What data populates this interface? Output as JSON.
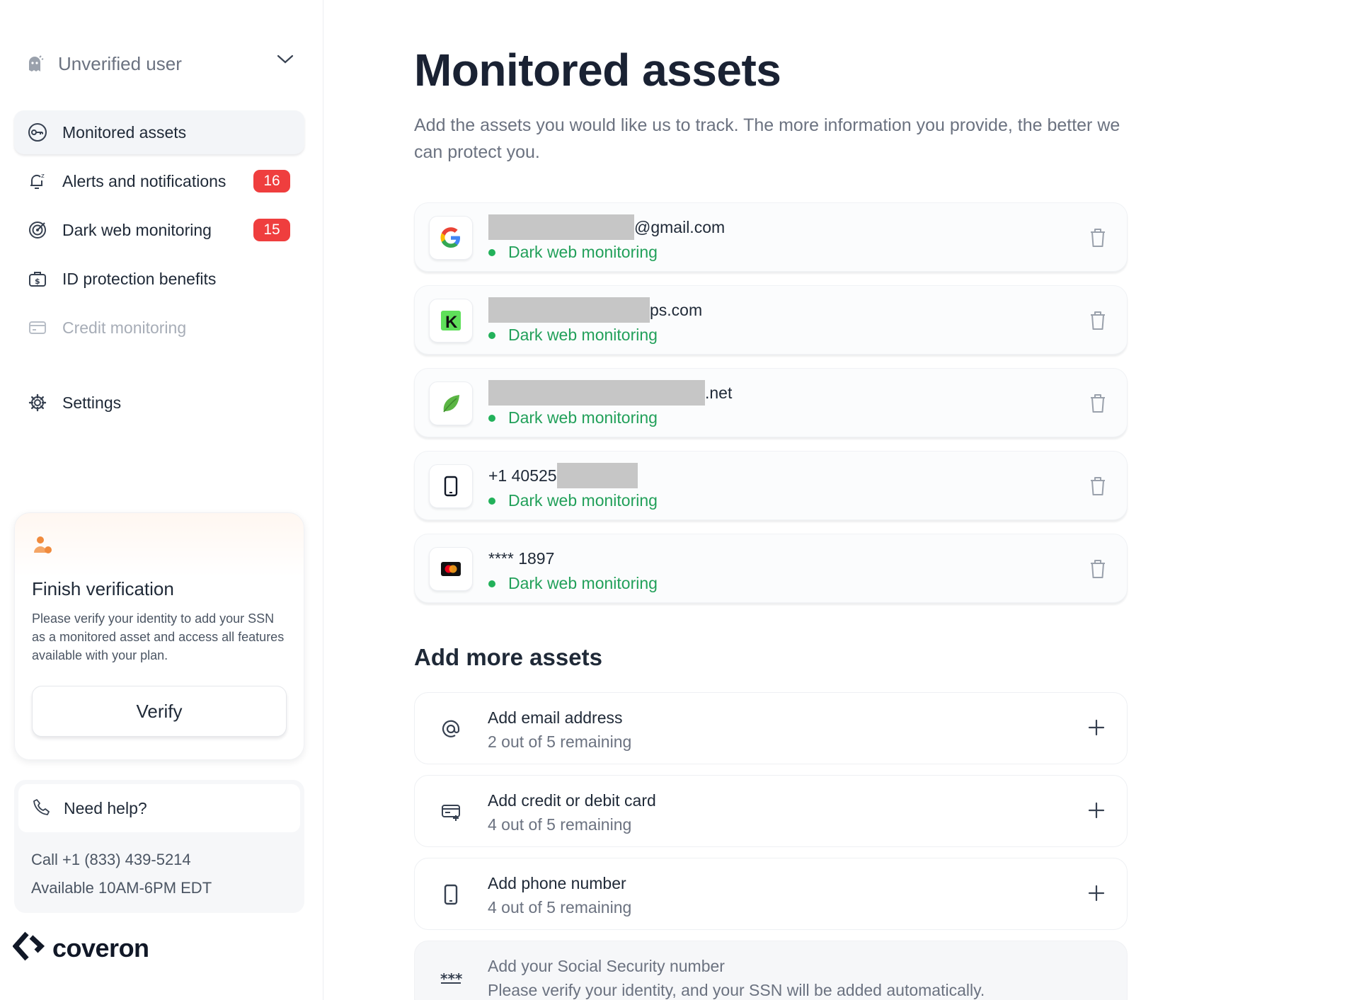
{
  "user": {
    "name": "Unverified user"
  },
  "nav": {
    "items": [
      {
        "label": "Monitored assets"
      },
      {
        "label": "Alerts and notifications",
        "badge": "16"
      },
      {
        "label": "Dark web monitoring",
        "badge": "15"
      },
      {
        "label": "ID protection benefits"
      },
      {
        "label": "Credit monitoring"
      }
    ],
    "settings": "Settings"
  },
  "verify_card": {
    "title": "Finish verification",
    "text": "Please verify your identity to add your SSN as a monitored asset and access all features available with your plan.",
    "button": "Verify"
  },
  "help": {
    "title": "Need help?",
    "phone": "Call +1 (833) 439-5214",
    "hours": "Available 10AM-6PM EDT"
  },
  "brand": {
    "name": "coveron"
  },
  "main": {
    "title": "Monitored assets",
    "subtitle": "Add the assets you would like us to track. The more information you provide, the better we can protect you."
  },
  "assets": [
    {
      "value": "@gmail.com",
      "status": "Dark web monitoring",
      "icon": "google-icon"
    },
    {
      "value": "ps.com",
      "status": "Dark web monitoring",
      "icon": "k-brand-icon"
    },
    {
      "value": ".net",
      "status": "Dark web monitoring",
      "icon": "leaf-icon"
    },
    {
      "value": "+1 40525",
      "status": "Dark web monitoring",
      "icon": "phone-icon"
    },
    {
      "value": "**** 1897",
      "status": "Dark web monitoring",
      "icon": "mastercard-icon"
    }
  ],
  "add_more": {
    "title": "Add more assets",
    "items": [
      {
        "title": "Add email address",
        "subtitle": "2 out of 5 remaining",
        "icon": "at-icon"
      },
      {
        "title": "Add credit or debit card",
        "subtitle": "4 out of 5 remaining",
        "icon": "card-add-icon"
      },
      {
        "title": "Add phone number",
        "subtitle": "4 out of 5 remaining",
        "icon": "phone-icon"
      },
      {
        "title": "Add your Social Security number",
        "subtitle": "Please verify your identity, and your SSN will be added automatically.",
        "icon": "asterisks-icon"
      }
    ]
  },
  "colors": {
    "badge": "#ef3e3e",
    "status_green": "#22a05a",
    "accent_orange": "#f08a3c"
  }
}
